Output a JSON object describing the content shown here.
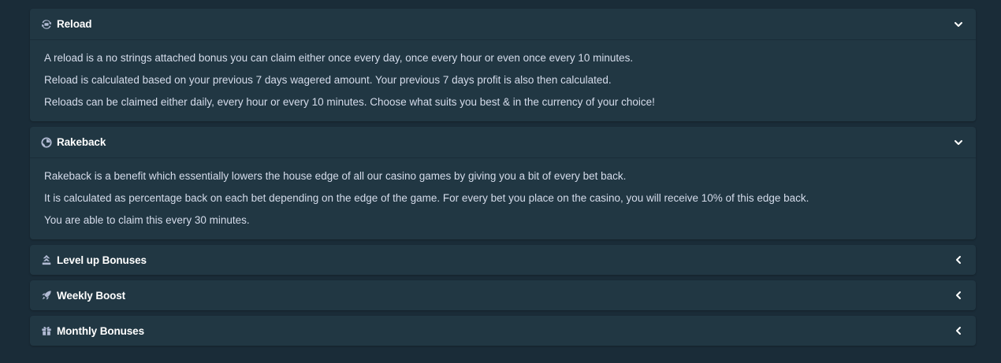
{
  "panels": [
    {
      "title": "Reload",
      "icon": "reload-icon",
      "expanded": true,
      "paragraphs": [
        "A reload is a no strings attached bonus you can claim either once every day, once every hour or even once every 10 minutes.",
        "Reload is calculated based on your previous 7 days wagered amount. Your previous 7 days profit is also then calculated.",
        "Reloads can be claimed either daily, every hour or every 10 minutes. Choose what suits you best & in the currency of your choice!"
      ]
    },
    {
      "title": "Rakeback",
      "icon": "rakeback-icon",
      "expanded": true,
      "paragraphs": [
        "Rakeback is a benefit which essentially lowers the house edge of all our casino games by giving you a bit of every bet back.",
        "It is calculated as percentage back on each bet depending on the edge of the game. For every bet you place on the casino, you will receive 10% of this edge back.",
        "You are able to claim this every 30 minutes."
      ]
    },
    {
      "title": "Level up Bonuses",
      "icon": "level-up-icon",
      "expanded": false
    },
    {
      "title": "Weekly Boost",
      "icon": "rocket-icon",
      "expanded": false
    },
    {
      "title": "Monthly Bonuses",
      "icon": "gift-icon",
      "expanded": false
    }
  ],
  "colors": {
    "page_bg": "#1a2c38",
    "panel_bg": "#213743",
    "title": "#ffffff",
    "body_text": "#d5dceb",
    "icon": "#b1bad3"
  }
}
